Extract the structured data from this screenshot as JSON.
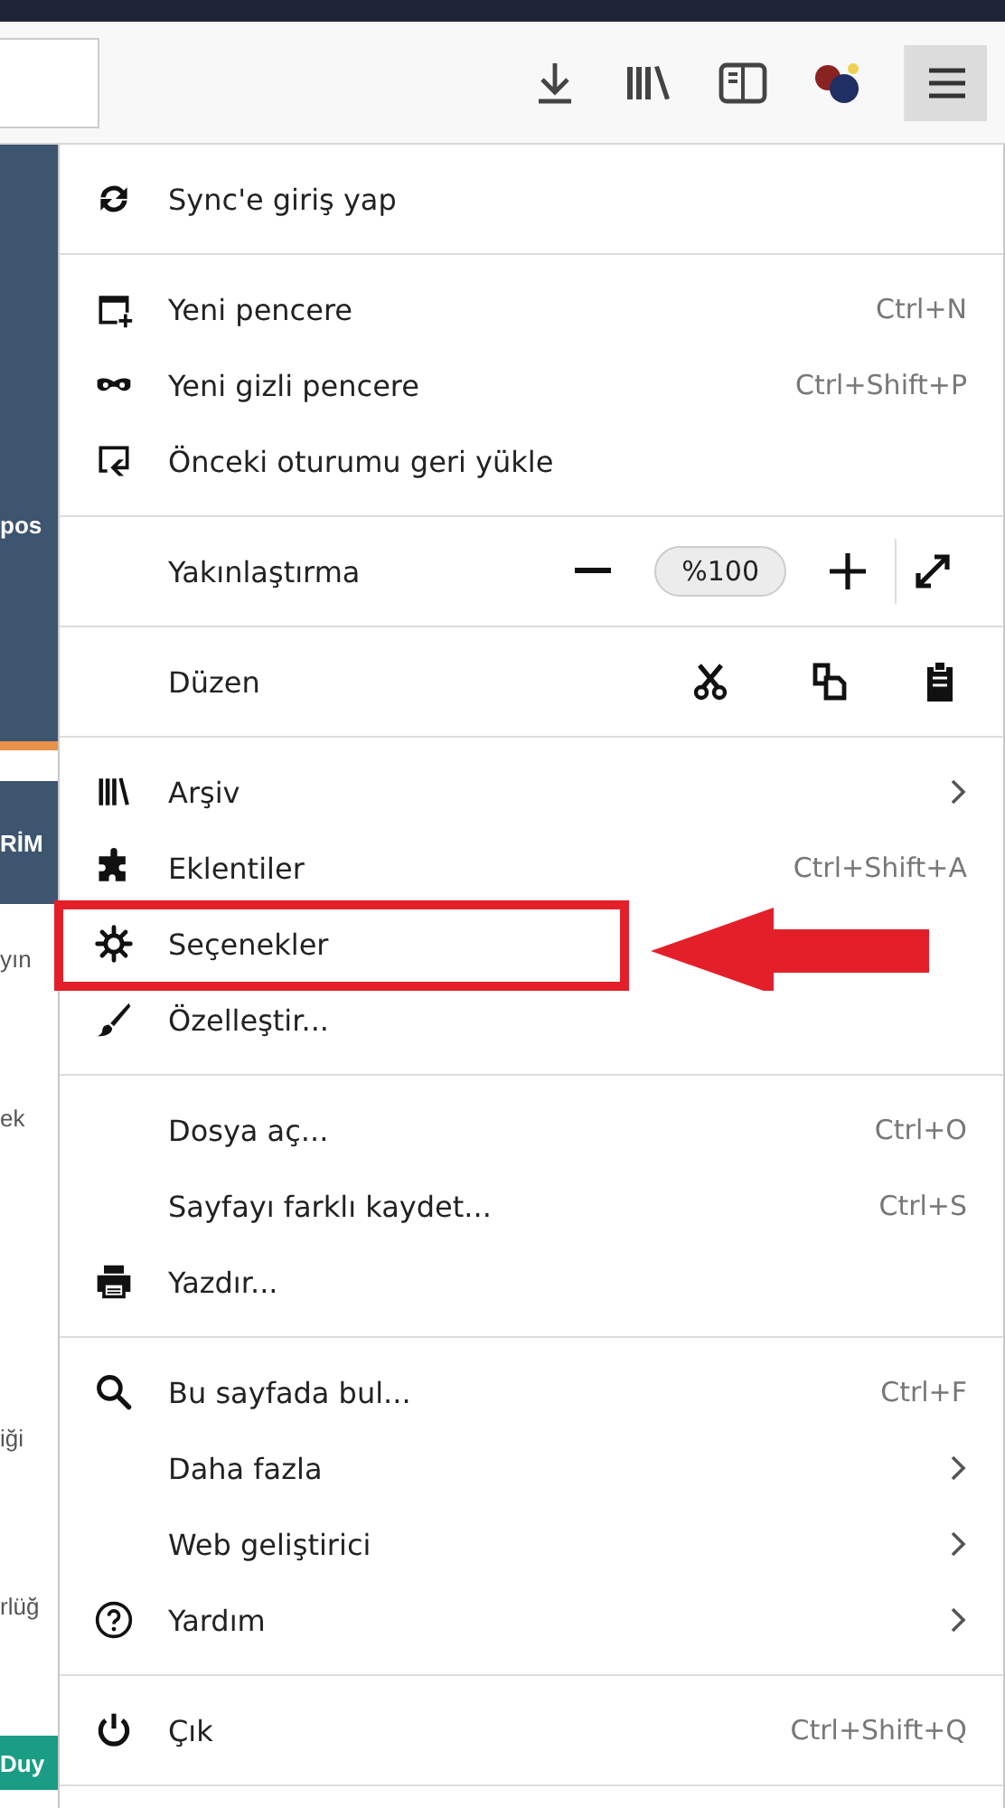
{
  "toolbar": {
    "menu_button": {
      "selected": true
    }
  },
  "page_behind": [
    {
      "kind": "dark"
    },
    {
      "kind": "dark",
      "text": "pos"
    },
    {
      "kind": "dark"
    },
    {
      "kind": "accent"
    },
    {
      "kind": "light"
    },
    {
      "kind": "dark",
      "text": "RİM"
    },
    {
      "kind": "light",
      "text": "yın"
    },
    {
      "kind": "light",
      "text": "ek"
    },
    {
      "kind": "light"
    },
    {
      "kind": "light",
      "text": "iği"
    },
    {
      "kind": "light",
      "text": "rlüğ"
    },
    {
      "kind": "light"
    },
    {
      "kind": "badge",
      "text": "Duy"
    },
    {
      "kind": "light"
    }
  ],
  "menu": {
    "sections": [
      [
        {
          "kind": "item",
          "label": "Sync'e giriş yap",
          "submenu": false,
          "highlighted": false
        }
      ],
      [
        {
          "kind": "item",
          "label": "Yeni pencere",
          "shortcut": "Ctrl+N",
          "submenu": false,
          "highlighted": false
        },
        {
          "kind": "item",
          "label": "Yeni gizli pencere",
          "shortcut": "Ctrl+Shift+P",
          "submenu": false,
          "highlighted": false
        },
        {
          "kind": "item",
          "label": "Önceki oturumu geri yükle",
          "submenu": false,
          "highlighted": false
        }
      ],
      [
        {
          "kind": "zoom",
          "label": "Yakınlaştırma",
          "value": "%100"
        }
      ],
      [
        {
          "kind": "edit",
          "label": "Düzen"
        }
      ],
      [
        {
          "kind": "item",
          "label": "Arşiv",
          "submenu": true,
          "highlighted": false
        },
        {
          "kind": "item",
          "label": "Eklentiler",
          "shortcut": "Ctrl+Shift+A",
          "submenu": false,
          "highlighted": false
        },
        {
          "kind": "item",
          "label": "Seçenekler",
          "submenu": false,
          "highlighted": true
        },
        {
          "kind": "item",
          "label": "Özelleştir...",
          "submenu": false,
          "highlighted": false
        }
      ],
      [
        {
          "kind": "item",
          "label": "Dosya aç...",
          "shortcut": "Ctrl+O",
          "submenu": false,
          "highlighted": false
        },
        {
          "kind": "item",
          "label": "Sayfayı farklı kaydet...",
          "shortcut": "Ctrl+S",
          "submenu": false,
          "highlighted": false
        },
        {
          "kind": "item",
          "label": "Yazdır...",
          "submenu": false,
          "highlighted": false
        }
      ],
      [
        {
          "kind": "item",
          "label": "Bu sayfada bul...",
          "shortcut": "Ctrl+F",
          "submenu": false,
          "highlighted": false
        },
        {
          "kind": "item",
          "label": "Daha fazla",
          "submenu": true,
          "highlighted": false
        },
        {
          "kind": "item",
          "label": "Web geliştirici",
          "submenu": true,
          "highlighted": false
        },
        {
          "kind": "item",
          "label": "Yardım",
          "submenu": true,
          "highlighted": false
        }
      ],
      [
        {
          "kind": "item",
          "label": "Çık",
          "shortcut": "Ctrl+Shift+Q",
          "submenu": false,
          "highlighted": false
        }
      ]
    ]
  }
}
